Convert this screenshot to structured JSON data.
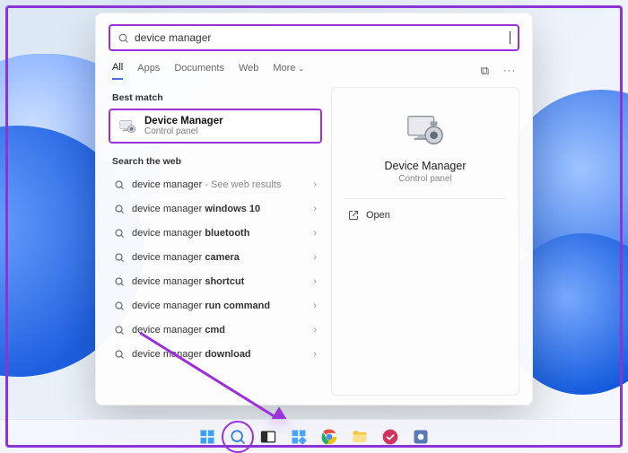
{
  "search": {
    "query": "device manager"
  },
  "tabs": {
    "all": "All",
    "apps": "Apps",
    "documents": "Documents",
    "web": "Web",
    "more": "More"
  },
  "sections": {
    "best_match": "Best match",
    "search_web": "Search the web"
  },
  "best_match": {
    "title": "Device Manager",
    "subtitle": "Control panel"
  },
  "web_results": [
    {
      "prefix": "device manager",
      "bold": "",
      "suffix": " - See web results"
    },
    {
      "prefix": "device manager ",
      "bold": "windows 10",
      "suffix": ""
    },
    {
      "prefix": "device manager ",
      "bold": "bluetooth",
      "suffix": ""
    },
    {
      "prefix": "device manager ",
      "bold": "camera",
      "suffix": ""
    },
    {
      "prefix": "device manager ",
      "bold": "shortcut",
      "suffix": ""
    },
    {
      "prefix": "device manager ",
      "bold": "run command",
      "suffix": ""
    },
    {
      "prefix": "device manager ",
      "bold": "cmd",
      "suffix": ""
    },
    {
      "prefix": "device manager ",
      "bold": "download",
      "suffix": ""
    }
  ],
  "preview": {
    "title": "Device Manager",
    "subtitle": "Control panel",
    "open": "Open"
  }
}
